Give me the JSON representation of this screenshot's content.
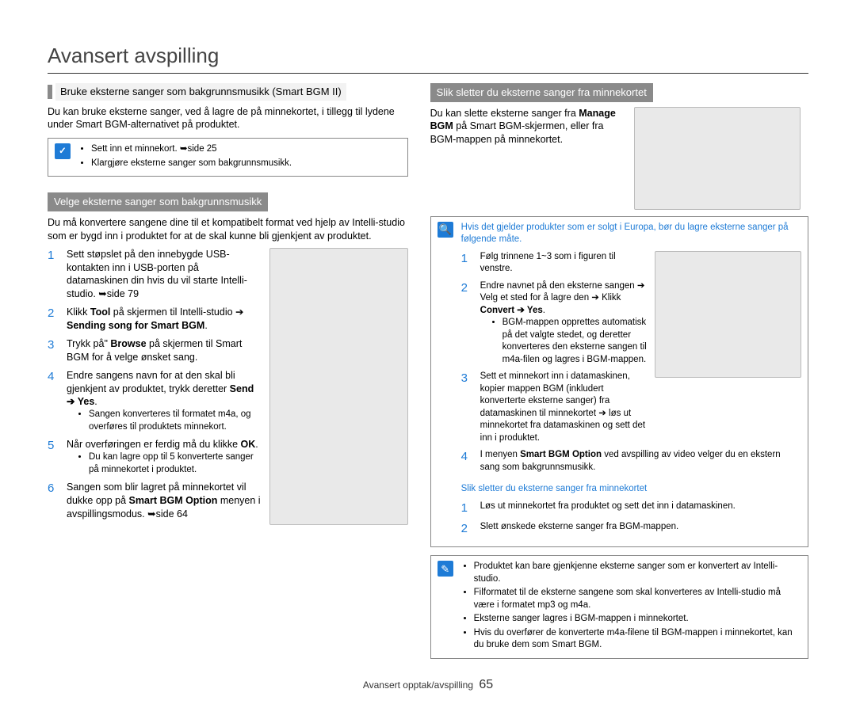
{
  "page": {
    "title": "Avansert avspilling",
    "footer_section": "Avansert opptak/avspilling",
    "page_number": "65"
  },
  "left": {
    "sec1_title": "Bruke eksterne sanger som bakgrunnsmusikk (Smart BGM II)",
    "sec1_body": "Du kan bruke eksterne sanger, ved å lagre de på minnekortet, i tillegg til lydene under Smart BGM-alternativet på produktet.",
    "box1_b1": "Sett inn et minnekort. ➥side 25",
    "box1_b2": "Klargjøre eksterne sanger som bakgrunnsmusikk.",
    "sec2_title": "Velge eksterne sanger som bakgrunnsmusikk",
    "sec2_body": "Du må konvertere sangene dine til et kompatibelt format ved hjelp av Intelli-studio som er bygd inn i produktet for at de skal kunne bli gjenkjent av produktet.",
    "s1": "Sett støpslet på den innebygde USB-kontakten inn i USB-porten på datamaskinen din hvis du vil starte Intelli-studio. ➥side 79",
    "s2a": "Klikk ",
    "s2b": "Tool",
    "s2c": " på skjermen til Intelli-studio ➔ ",
    "s2d": "Sending song for Smart BGM",
    "s2e": ".",
    "s3a": "Trykk på\" ",
    "s3b": "Browse",
    "s3c": " på skjermen til Smart BGM for å velge ønsket sang.",
    "s4a": "Endre sangens navn for at den skal bli gjenkjent av produktet, trykk deretter ",
    "s4b": "Send ➔ Yes",
    "s4c": ".",
    "s4_sub": "Sangen konverteres til formatet m4a, og overføres til produktets minnekort.",
    "s5a": "Når overføringen er ferdig må du klikke ",
    "s5b": "OK",
    "s5c": ".",
    "s5_sub": "Du kan lagre opp til 5 konverterte sanger på minnekortet i produktet.",
    "s6a": "Sangen som blir lagret på minnekortet vil dukke opp på ",
    "s6b": "Smart BGM Option",
    "s6c": " menyen i avspillingsmodus. ➥side 64"
  },
  "right": {
    "sec1_title": "Slik sletter du eksterne sanger fra minnekortet",
    "sec1_a": "Du kan slette eksterne sanger fra ",
    "sec1_b": "Manage BGM",
    "sec1_c": " på Smart BGM-skjermen, eller fra BGM-mappen på minnekortet.",
    "box2_line1": "Hvis det gjelder produkter som er solgt i Europa, bør du lagre eksterne sanger på følgende måte.",
    "s1": "Følg trinnene 1~3 som i figuren til venstre.",
    "s2a": "Endre navnet på den eksterne sangen ➔ Velg et sted for å lagre den ➔ Klikk ",
    "s2b": "Convert ➔ Yes",
    "s2c": ".",
    "s2_sub": "BGM-mappen opprettes automatisk på det valgte stedet, og deretter konverteres den eksterne sangen til m4a-filen og lagres i BGM-mappen.",
    "s3": "Sett et minnekort inn i datamaskinen, kopier mappen BGM (inkludert konverterte eksterne sanger) fra datamaskinen til minnekortet ➔ løs ut minnekortet fra datamaskinen og sett det inn i produktet.",
    "s4a": "I menyen ",
    "s4b": "Smart BGM Option",
    "s4c": " ved avspilling av video velger du en ekstern sang som bakgrunnsmusikk.",
    "sub_hdr": "Slik sletter du eksterne sanger fra minnekortet",
    "d1": "Løs ut minnekortet fra produktet og sett det inn i datamaskinen.",
    "d2": "Slett ønskede eksterne sanger fra BGM-mappen.",
    "box3_b1": "Produktet kan bare gjenkjenne eksterne sanger som er konvertert av Intelli-studio.",
    "box3_b2": "Filformatet til de eksterne sangene som skal konverteres av Intelli-studio må være i formatet mp3 og m4a.",
    "box3_b3": "Eksterne sanger lagres i BGM-mappen i minnekortet.",
    "box3_b4": "Hvis du overfører de konverterte m4a-filene til BGM-mappen i minnekortet, kan du bruke dem som Smart BGM."
  }
}
